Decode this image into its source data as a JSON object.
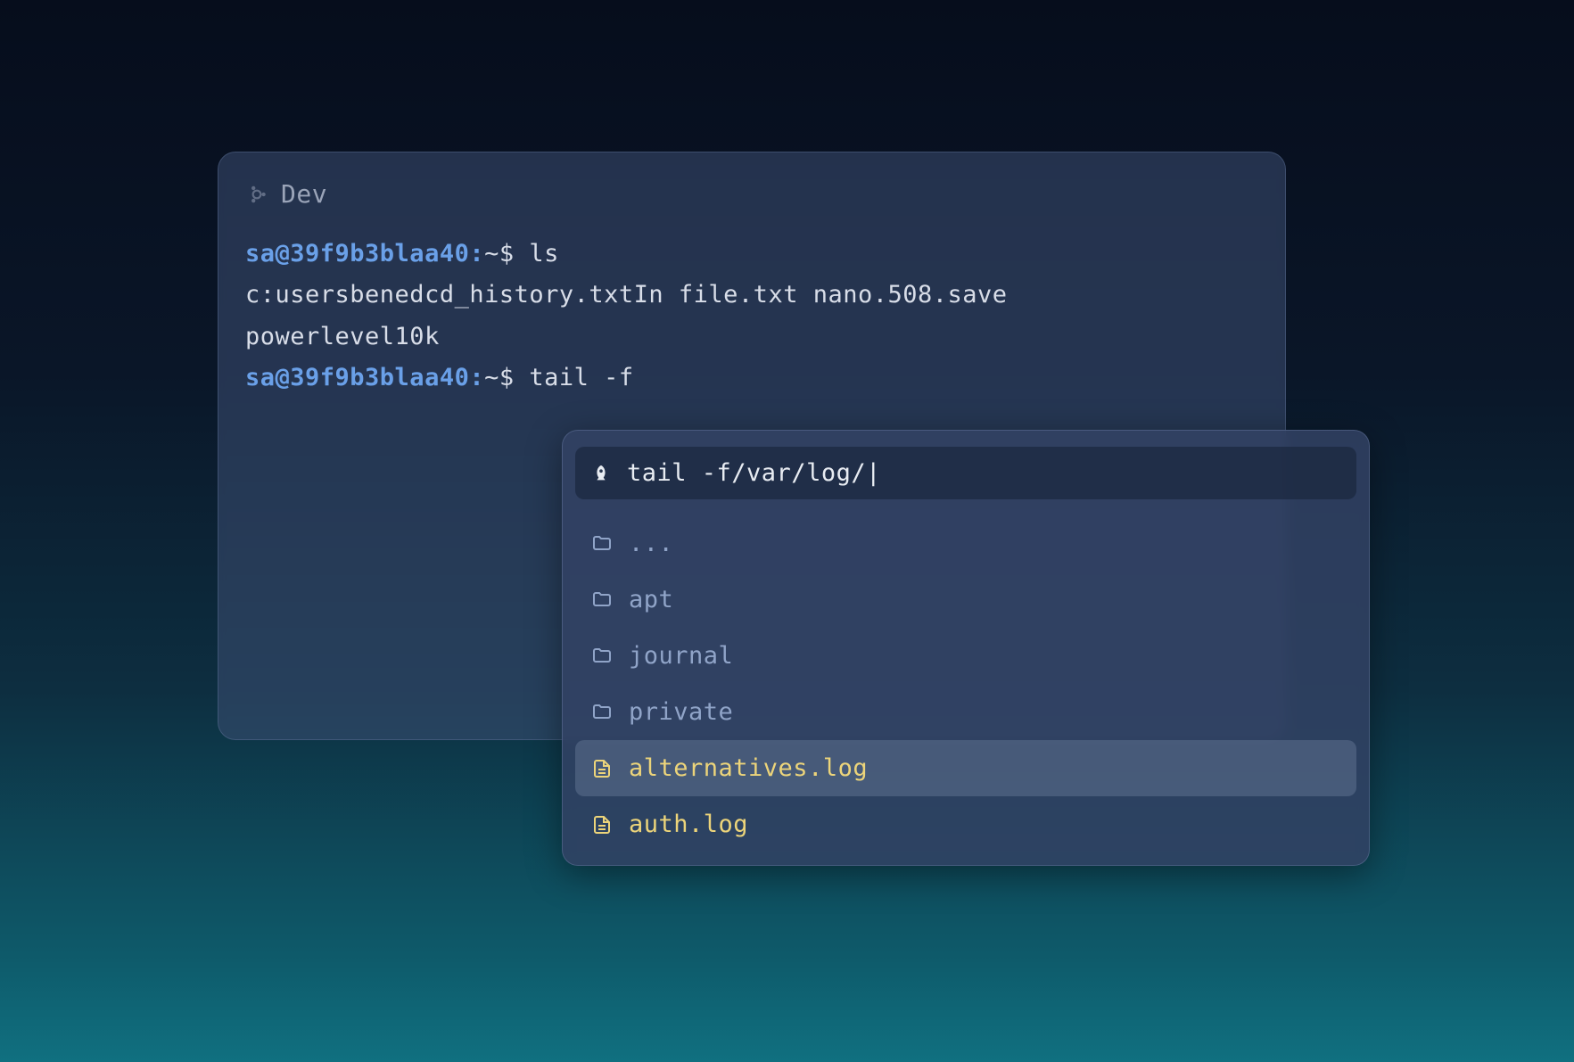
{
  "terminal": {
    "title": "Dev",
    "lines": [
      {
        "prompt_user": "sa@39f9b3blaa40:",
        "prompt_path": "~$ ",
        "command": "ls"
      },
      {
        "output": "c:usersbenedcd_history.txtIn file.txt nano.508.save"
      },
      {
        "output": "powerlevel10k"
      },
      {
        "prompt_user": "sa@39f9b3blaa40:",
        "prompt_path": "~$ ",
        "command": "tail -f"
      }
    ]
  },
  "autocomplete": {
    "input_text": "tail -f/var/log/|",
    "items": [
      {
        "type": "folder",
        "label": "...",
        "selected": false
      },
      {
        "type": "folder",
        "label": "apt",
        "selected": false
      },
      {
        "type": "folder",
        "label": "journal",
        "selected": false
      },
      {
        "type": "folder",
        "label": "private",
        "selected": false
      },
      {
        "type": "file",
        "label": "alternatives.log",
        "selected": true
      },
      {
        "type": "file",
        "label": "auth.log",
        "selected": false
      }
    ]
  },
  "colors": {
    "prompt_user": "#6aa0e8",
    "text": "#d8dde8",
    "folder": "#90a4c8",
    "file": "#ecd47a"
  }
}
